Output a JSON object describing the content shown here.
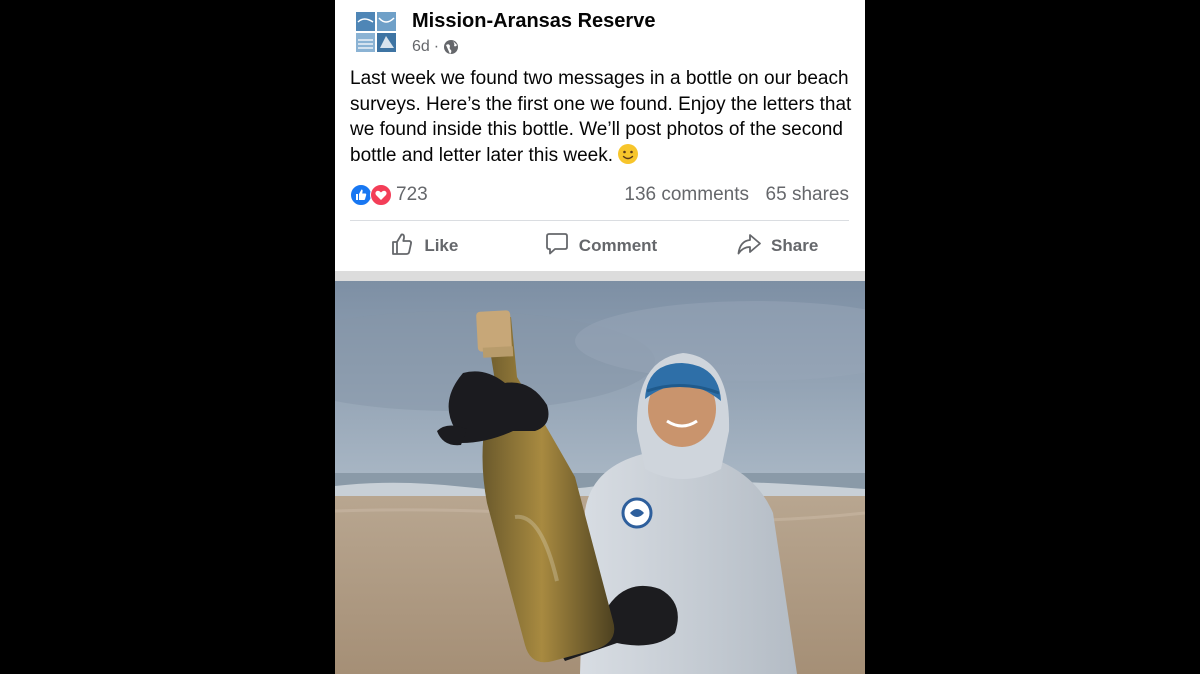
{
  "post": {
    "page_name": "Mission-Aransas Reserve",
    "time": "6d",
    "meta_separator": "·",
    "audience_icon": "globe-icon",
    "text": "Last week we found two messages in a bottle on our beach surveys. Here’s the first one we found. Enjoy the letters that we found inside this bottle. We’ll post photos of the second bottle and letter later this week.",
    "text_emoji": "slightly-smiling-face-icon",
    "reactions": {
      "icons": [
        "like-reaction-icon",
        "love-reaction-icon"
      ],
      "count": "723"
    },
    "comments": "136 comments",
    "shares": "65 shares",
    "actions": {
      "like": "Like",
      "comment": "Comment",
      "share": "Share"
    }
  },
  "colors": {
    "background": "#000000",
    "card": "#ffffff",
    "secondary_text": "#65676b",
    "like_blue": "#1877f2",
    "love_red": "#f33e58"
  }
}
